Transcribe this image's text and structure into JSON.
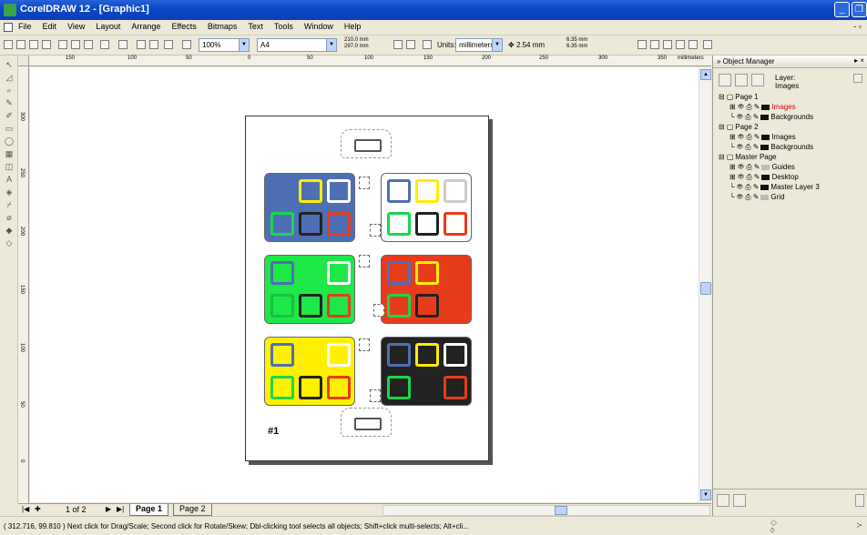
{
  "window": {
    "title": "CorelDRAW 12 - [Graphic1]"
  },
  "menu": [
    "File",
    "Edit",
    "View",
    "Layout",
    "Arrange",
    "Effects",
    "Bitmaps",
    "Text",
    "Tools",
    "Window",
    "Help"
  ],
  "toolbar": {
    "zoom": "100%",
    "page_size": "A4",
    "width": "210.0 mm",
    "height": "297.0 mm",
    "units_label": "Units:",
    "units": "millimeters",
    "nudge": "2.54 mm",
    "dup_x": "6.35 mm",
    "dup_y": "6.35 mm"
  },
  "ruler": {
    "h_ticks": [
      "150",
      "100",
      "50",
      "0",
      "50",
      "100",
      "150",
      "200",
      "250",
      "300",
      "350"
    ],
    "h_unit": "millimeters",
    "v_ticks": [
      "300",
      "250",
      "200",
      "150",
      "100",
      "50",
      "0"
    ],
    "v_unit": "millimeters"
  },
  "page": {
    "number_label": "#1"
  },
  "trays": [
    {
      "bg": "#4f6fb5",
      "wells": [
        "#4f6fb5",
        "#ffee00",
        "#ffffff",
        "#18d84a",
        "#222222",
        "#e63c1c"
      ],
      "fills": [
        "#4f6fb5",
        "#4f6fb5",
        "#4f6fb5",
        "#4f6fb5",
        "#4f6fb5",
        "#4f6fb5"
      ]
    },
    {
      "bg": "#ffffff",
      "wells": [
        "#4f6fb5",
        "#ffee00",
        "#cccccc",
        "#18d84a",
        "#222222",
        "#e63c1c"
      ],
      "fills": [
        "#ffffff",
        "#ffffff",
        "#ffffff",
        "#ffffff",
        "#ffffff",
        "#ffffff"
      ]
    },
    {
      "bg": "#1ee848",
      "wells": [
        "#4f6fb5",
        "#1ee848",
        "#ffffff",
        "#18c040",
        "#222222",
        "#e63c1c"
      ],
      "fills": [
        "#1ee848",
        "#1ee848",
        "#1ee848",
        "#1ee848",
        "#1ee848",
        "#1ee848"
      ]
    },
    {
      "bg": "#e63c1c",
      "wells": [
        "#4f6fb5",
        "#ffee00",
        "#e63c1c",
        "#18d84a",
        "#222222",
        "#e63c1c"
      ],
      "fills": [
        "#e63c1c",
        "#e63c1c",
        "#e63c1c",
        "#e63c1c",
        "#e63c1c",
        "#e63c1c"
      ]
    },
    {
      "bg": "#fff000",
      "wells": [
        "#4f6fb5",
        "#fff000",
        "#ffffff",
        "#18d84a",
        "#222222",
        "#e63c1c"
      ],
      "fills": [
        "#fff000",
        "#fff000",
        "#fff000",
        "#fff000",
        "#fff000",
        "#fff000"
      ]
    },
    {
      "bg": "#222222",
      "wells": [
        "#4f6fb5",
        "#ffee00",
        "#ffffff",
        "#18d84a",
        "#222222",
        "#e63c1c"
      ],
      "fills": [
        "#222222",
        "#222222",
        "#222222",
        "#222222",
        "#222222",
        "#222222"
      ]
    }
  ],
  "pages_nav": {
    "count": "1 of 2",
    "tabs": [
      "Page 1",
      "Page 2"
    ]
  },
  "status": {
    "text": "( 312.716, 99.810 )  Next click for Drag/Scale; Second click for Rotate/Skew; Dbl-clicking tool selects all objects; Shift+click multi-selects; Alt+cli..."
  },
  "object_manager": {
    "title": "Object Manager",
    "layer_label": "Layer:",
    "current_layer": "Images",
    "tree": [
      {
        "label": "Page 1",
        "level": 0,
        "type": "page"
      },
      {
        "label": "Images",
        "level": 1,
        "type": "layer",
        "active": true
      },
      {
        "label": "Backgrounds",
        "level": 1,
        "type": "layer"
      },
      {
        "label": "Page 2",
        "level": 0,
        "type": "page"
      },
      {
        "label": "Images",
        "level": 1,
        "type": "layer"
      },
      {
        "label": "Backgrounds",
        "level": 1,
        "type": "layer"
      },
      {
        "label": "Master Page",
        "level": 0,
        "type": "page"
      },
      {
        "label": "Guides",
        "level": 1,
        "type": "layer",
        "dim": true
      },
      {
        "label": "Desktop",
        "level": 1,
        "type": "layer"
      },
      {
        "label": "Master Layer 3",
        "level": 1,
        "type": "layer"
      },
      {
        "label": "Grid",
        "level": 1,
        "type": "layer",
        "dim": true
      }
    ]
  }
}
